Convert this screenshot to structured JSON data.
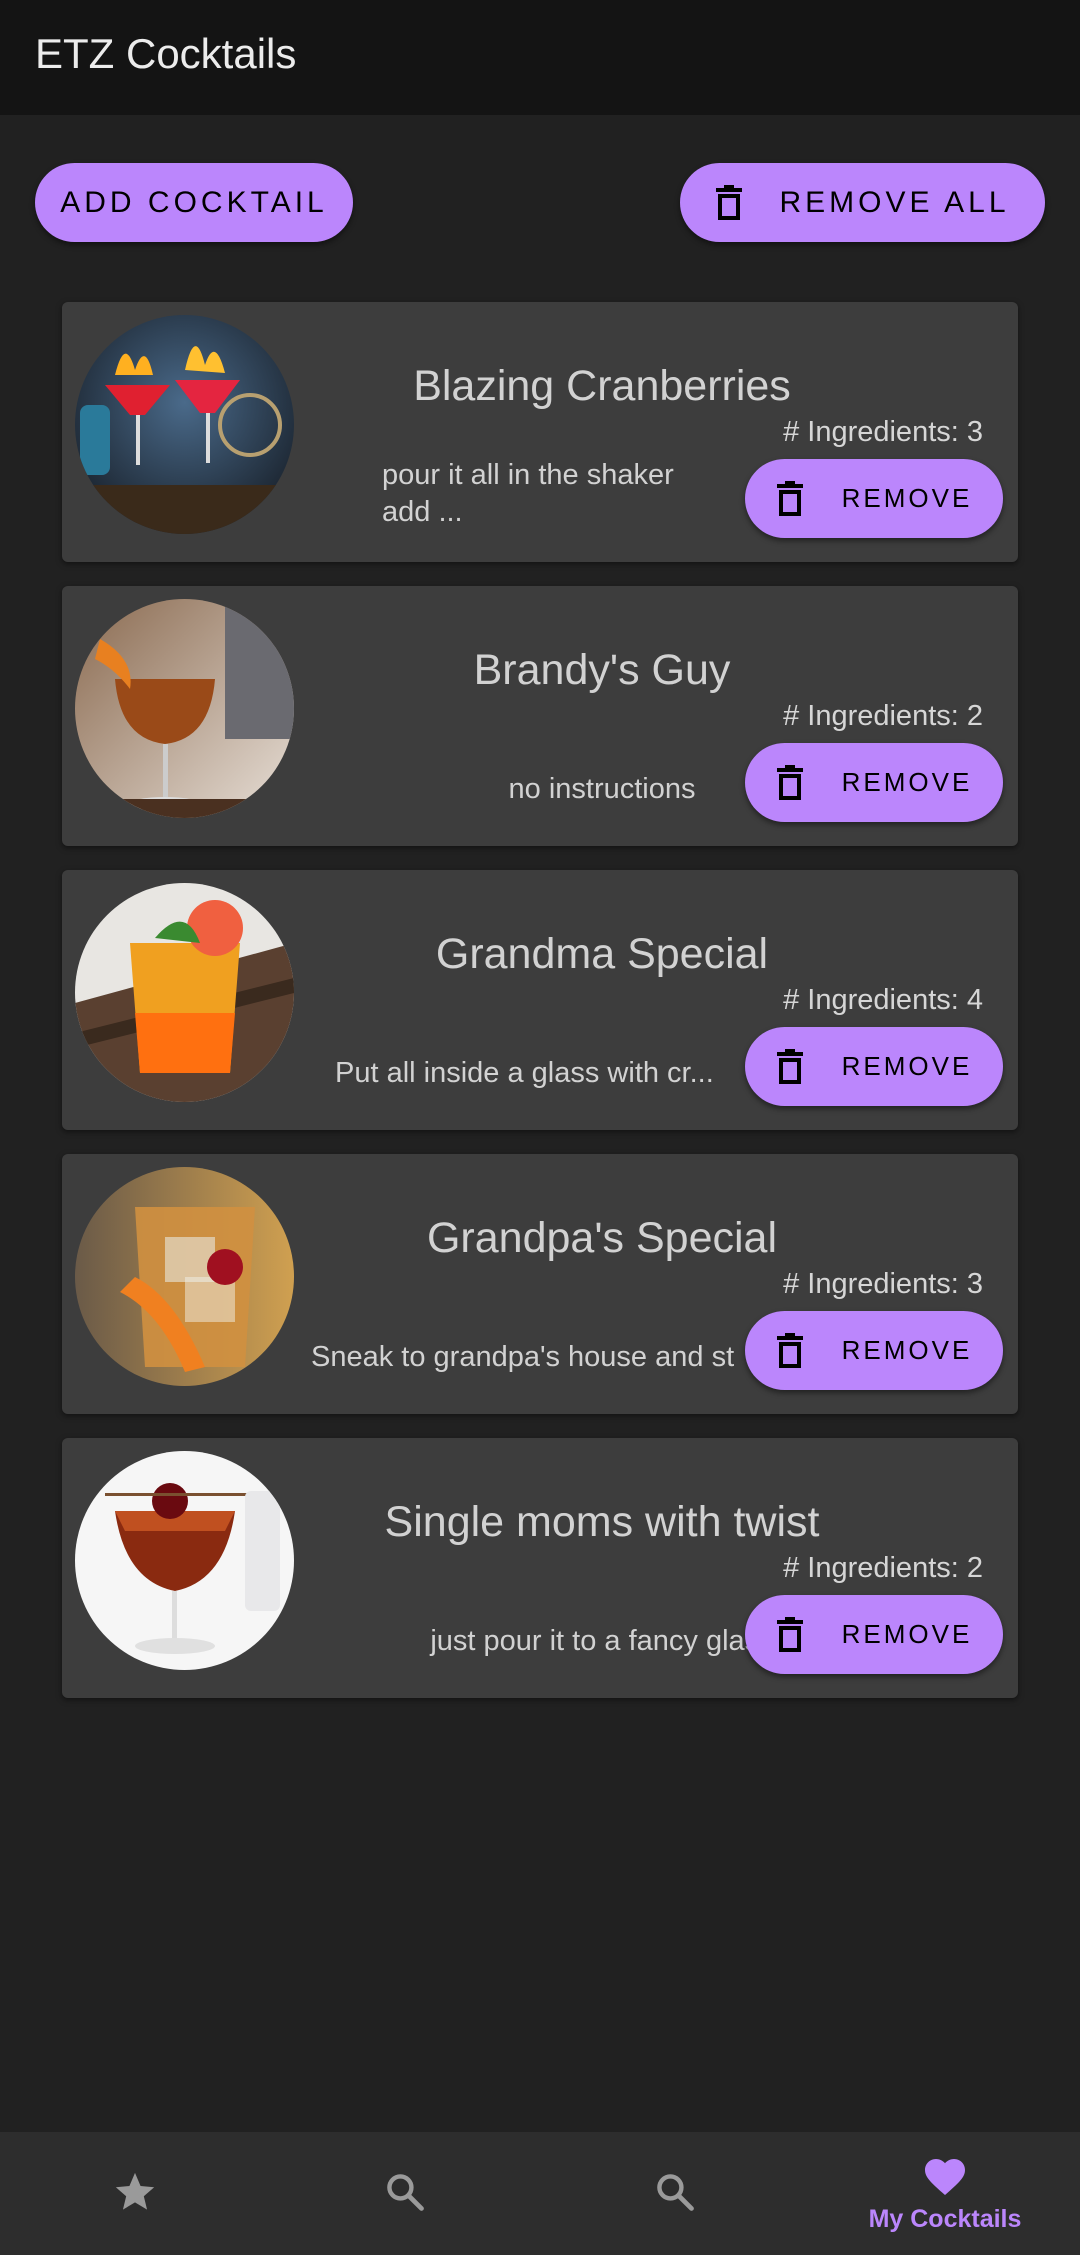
{
  "app": {
    "title": "ETZ Cocktails"
  },
  "actions": {
    "add_label": "ADD COCKTAIL",
    "remove_all_label": "REMOVE ALL"
  },
  "cocktails": [
    {
      "name": "Blazing Cranberries",
      "instructions": "pour it all in the shaker\nadd ...",
      "ingredients": "# Ingredients: 3",
      "remove_label": "REMOVE"
    },
    {
      "name": "Brandy's Guy",
      "instructions": "no instructions",
      "ingredients": "# Ingredients: 2",
      "remove_label": "REMOVE"
    },
    {
      "name": "Grandma Special",
      "instructions": "Put all inside a glass with cr...",
      "ingredients": "# Ingredients: 4",
      "remove_label": "REMOVE"
    },
    {
      "name": "Grandpa's Special",
      "instructions": "Sneak to grandpa's house and st",
      "ingredients": "# Ingredients: 3",
      "remove_label": "REMOVE"
    },
    {
      "name": "Single moms with twist",
      "instructions": "just pour it to a fancy glass",
      "ingredients": "# Ingredients: 2",
      "remove_label": "REMOVE"
    }
  ],
  "nav": {
    "items": [
      {
        "icon": "star-icon",
        "label": ""
      },
      {
        "icon": "search-icon",
        "label": ""
      },
      {
        "icon": "search-icon",
        "label": ""
      },
      {
        "icon": "heart-icon",
        "label": "My Cocktails"
      }
    ]
  },
  "colors": {
    "accent": "#bb86fc",
    "background": "#212121",
    "card": "#3d3d3d",
    "appbar": "#141414"
  }
}
